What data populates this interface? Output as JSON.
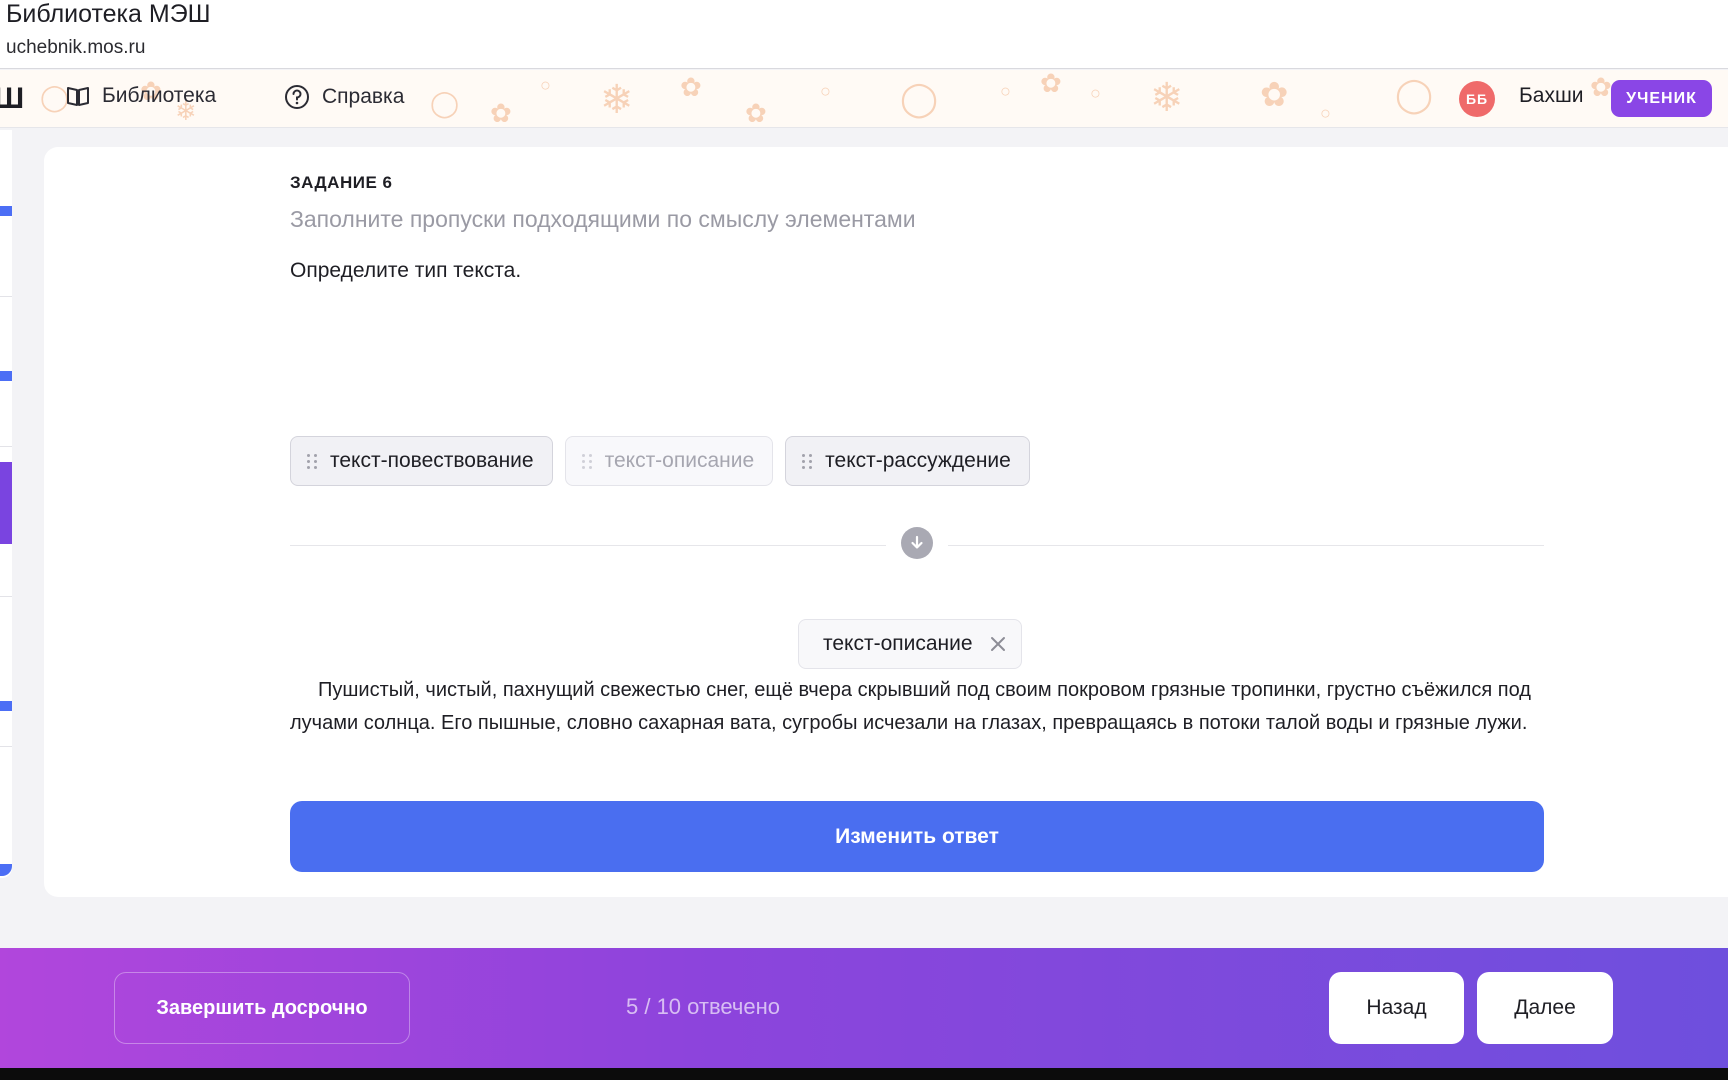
{
  "browser": {
    "title": "Библиотека МЭШ",
    "url": "uchebnik.mos.ru"
  },
  "header": {
    "logo_fragment": "Ш",
    "nav": [
      {
        "label": "Библиотека",
        "icon": "book-icon"
      },
      {
        "label": "Справка",
        "icon": "help-circle-icon"
      }
    ],
    "user": {
      "initials": "ББ",
      "name": "Бахши",
      "role": "УЧЕНИК",
      "avatar_color": "#ef6a6a",
      "role_color": "#8a46e6"
    }
  },
  "task": {
    "label": "ЗАДАНИЕ 6",
    "hint": "Заполните пропуски подходящими по смыслу элементами",
    "question": "Определите тип текста.",
    "options": [
      {
        "label": "текст-повествование",
        "used": false
      },
      {
        "label": "текст-описание",
        "used": true
      },
      {
        "label": "текст-рассуждение",
        "used": false
      }
    ],
    "divider_icon": "arrow-down-icon",
    "selected_answer": "текст-описание",
    "remove_icon": "close-icon",
    "passage": "Пушистый, чистый, пахнущий свежестью снег, ещё вчера скрывший под своим покровом грязные тропинки, грустно съёжился под лучами солнца. Его пышные, словно сахарная вата, сугробы исчезали на глазах, превращаясь в потоки талой воды и грязные лужи.",
    "change_button": "Изменить ответ",
    "accent_color": "#4a6ef0"
  },
  "footer": {
    "finish_button": "Завершить досрочно",
    "progress": "5 / 10 отвечено",
    "answered": 5,
    "total": 10,
    "back_button": "Назад",
    "next_button": "Далее"
  }
}
